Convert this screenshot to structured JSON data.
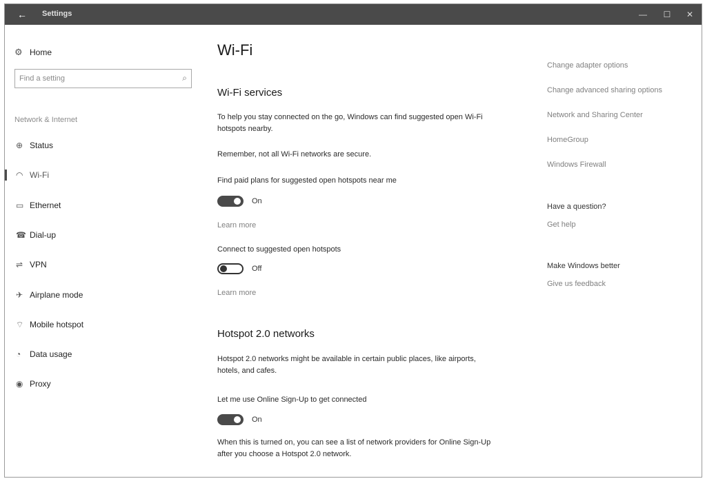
{
  "window": {
    "title": "Settings",
    "back_glyph": "←",
    "controls": {
      "minimize": "—",
      "maximize": "☐",
      "close": "✕"
    }
  },
  "sidebar": {
    "home": {
      "icon": "gear-icon",
      "glyph": "⚙",
      "label": "Home"
    },
    "search": {
      "placeholder": "Find a setting",
      "icon": "search-icon",
      "glyph": "⌕"
    },
    "category": "Network & Internet",
    "items": [
      {
        "label": "Status",
        "icon": "globe-icon",
        "glyph": "⊕",
        "selected": false
      },
      {
        "label": "Wi-Fi",
        "icon": "wifi-icon",
        "glyph": "◠",
        "selected": true
      },
      {
        "label": "Ethernet",
        "icon": "ethernet-icon",
        "glyph": "▭",
        "selected": false
      },
      {
        "label": "Dial-up",
        "icon": "phone-icon",
        "glyph": "☎",
        "selected": false
      },
      {
        "label": "VPN",
        "icon": "vpn-icon",
        "glyph": "⇌",
        "selected": false
      },
      {
        "label": "Airplane mode",
        "icon": "airplane-icon",
        "glyph": "✈",
        "selected": false
      },
      {
        "label": "Mobile hotspot",
        "icon": "hotspot-icon",
        "glyph": "⌔",
        "selected": false
      },
      {
        "label": "Data usage",
        "icon": "data-usage-icon",
        "glyph": "◔",
        "selected": false
      },
      {
        "label": "Proxy",
        "icon": "proxy-icon",
        "glyph": "◉",
        "selected": false
      }
    ]
  },
  "main": {
    "title": "Wi-Fi",
    "wifi_services": {
      "heading": "Wi-Fi services",
      "intro": "To help you stay connected on the go, Windows can find suggested open Wi-Fi hotspots nearby.",
      "warning": "Remember, not all Wi-Fi networks are secure.",
      "paid_plans": {
        "label": "Find paid plans for suggested open hotspots near me",
        "state": "On",
        "learn_more": "Learn more"
      },
      "suggested_hotspots": {
        "label": "Connect to suggested open hotspots",
        "state": "Off",
        "learn_more": "Learn more"
      }
    },
    "hotspot20": {
      "heading": "Hotspot 2.0 networks",
      "intro": "Hotspot 2.0 networks might be available in certain public places, like airports, hotels, and cafes.",
      "online_signup": {
        "label": "Let me use Online Sign-Up to get connected",
        "state": "On"
      },
      "footer": "When this is turned on, you can see a list of network providers for Online Sign-Up after you choose a Hotspot 2.0 network."
    }
  },
  "rail": {
    "related": [
      "Change adapter options",
      "Change advanced sharing options",
      "Network and Sharing Center",
      "HomeGroup",
      "Windows Firewall"
    ],
    "question": {
      "heading": "Have a question?",
      "link": "Get help"
    },
    "feedback": {
      "heading": "Make Windows better",
      "link": "Give us feedback"
    }
  }
}
